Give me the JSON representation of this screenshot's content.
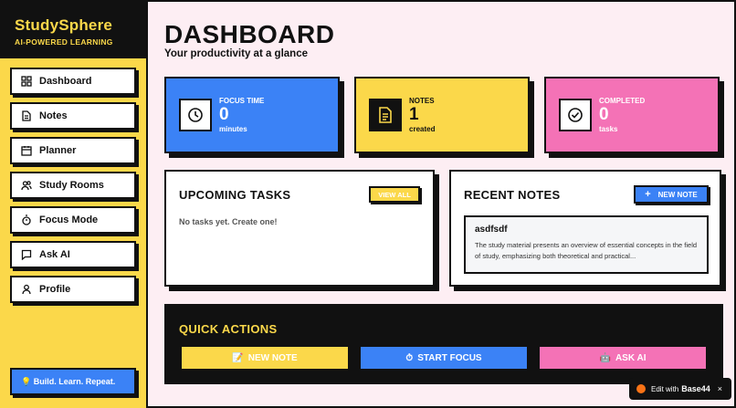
{
  "brand": {
    "title": "StudySphere",
    "subtitle": "AI-POWERED LEARNING"
  },
  "sidebar": {
    "items": [
      {
        "label": "Dashboard",
        "icon": "grid-icon"
      },
      {
        "label": "Notes",
        "icon": "document-icon"
      },
      {
        "label": "Planner",
        "icon": "calendar-icon"
      },
      {
        "label": "Study Rooms",
        "icon": "users-icon"
      },
      {
        "label": "Focus Mode",
        "icon": "stopwatch-icon"
      },
      {
        "label": "Ask AI",
        "icon": "chat-icon"
      },
      {
        "label": "Profile",
        "icon": "user-icon"
      }
    ],
    "tagline": "💡 Build. Learn. Repeat."
  },
  "header": {
    "title": "DASHBOARD",
    "subtitle": "Your productivity at a glance"
  },
  "stats": [
    {
      "label": "FOCUS TIME",
      "value": "0",
      "unit": "minutes",
      "icon": "clock-icon",
      "color": "#3b82f6"
    },
    {
      "label": "NOTES",
      "value": "1",
      "unit": "created",
      "icon": "document-icon",
      "color": "#fbd84a"
    },
    {
      "label": "COMPLETED",
      "value": "0",
      "unit": "tasks",
      "icon": "check-circle-icon",
      "color": "#f472b6"
    }
  ],
  "upcoming": {
    "title": "UPCOMING TASKS",
    "view_all": "VIEW ALL",
    "empty": "No tasks yet. Create one!"
  },
  "recent": {
    "title": "RECENT NOTES",
    "new_note": "NEW NOTE",
    "note": {
      "title": "asdfsdf",
      "body": "The study material presents an overview of essential concepts in the field of study, emphasizing both theoretical and practical..."
    }
  },
  "quick": {
    "title": "QUICK ACTIONS",
    "actions": [
      {
        "label": "NEW NOTE",
        "emoji": "📝",
        "color": "#fbd84a"
      },
      {
        "label": "START FOCUS",
        "emoji": "⏱",
        "color": "#3b82f6"
      },
      {
        "label": "ASK AI",
        "emoji": "🤖",
        "color": "#f472b6"
      }
    ]
  },
  "badge": {
    "prefix": "Edit with",
    "brand": "Base44",
    "close": "×"
  },
  "colors": {
    "accent_yellow": "#fbd84a",
    "accent_blue": "#3b82f6",
    "accent_pink": "#f472b6",
    "background": "#fdeef3"
  }
}
